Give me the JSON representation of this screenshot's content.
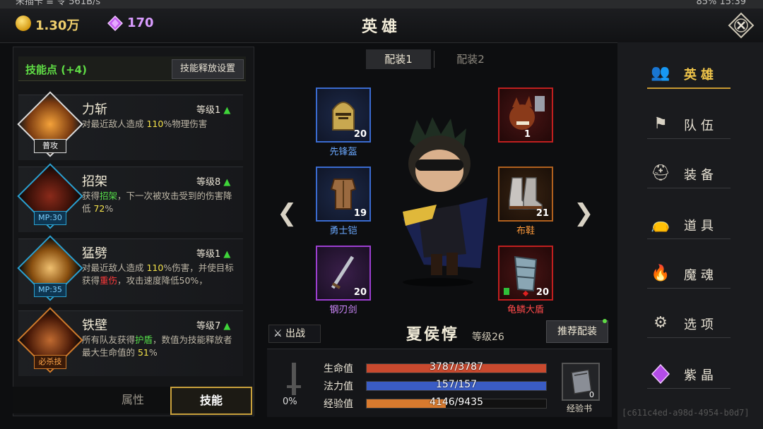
{
  "status_bar": {
    "left": "未插卡 ≡ 令 561B/s",
    "right": "85% 15:39"
  },
  "currency": {
    "gold": "1.30万",
    "gems": "170"
  },
  "title": "英雄",
  "skills_panel": {
    "points_label": "技能点 (+4)",
    "release_settings": "技能释放设置",
    "skills": [
      {
        "name": "力斩",
        "tag": "普攻",
        "level": "等级1",
        "desc_pre": "对最近敌人造成 ",
        "desc_hl": "110",
        "desc_post": "%物理伤害",
        "desc_hl2": "",
        "desc_post2": ""
      },
      {
        "name": "招架",
        "tag": "MP:30",
        "level": "等级8",
        "desc_pre": "获得",
        "desc_hl": "招架",
        "desc_post": "，下一次被攻击受到的伤害降低 ",
        "desc_hl2": "72",
        "desc_post2": "%"
      },
      {
        "name": "猛劈",
        "tag": "MP:35",
        "level": "等级1",
        "desc_pre": "对最近敌人造成 ",
        "desc_hl": "110",
        "desc_post": "%伤害，并使目标获得",
        "desc_hl2": "重伤",
        "desc_post2": "，攻击速度降低50%，"
      },
      {
        "name": "铁壁",
        "tag": "必杀技",
        "level": "等级7",
        "desc_pre": "所有队友获得",
        "desc_hl": "护盾",
        "desc_post": "，数值为技能释放者最大生命值的 ",
        "desc_hl2": "51",
        "desc_post2": "%"
      }
    ],
    "tabs": {
      "attributes": "属性",
      "skills": "技能"
    }
  },
  "loadout_tabs": [
    "配装1",
    "配装2"
  ],
  "equipment": {
    "helmet": {
      "label": "先锋盔",
      "count": "20",
      "icon": "helmet-icon",
      "color": "#3a6bd0"
    },
    "armor": {
      "label": "勇士铠",
      "count": "19",
      "icon": "armor-icon",
      "color": "#3a6bd0"
    },
    "sword": {
      "label": "钢刃剑",
      "count": "20",
      "icon": "sword-icon",
      "color": "#9c3fd0"
    },
    "pet": {
      "label": "",
      "count": "1",
      "icon": "werewolf-icon",
      "color": "#c01f1f"
    },
    "boots": {
      "label": "布鞋",
      "count": "21",
      "icon": "boots-icon",
      "color": "#b0601e"
    },
    "shield": {
      "label": "龟鳞大盾",
      "count": "20",
      "icon": "shield-icon",
      "color": "#c01f1f"
    }
  },
  "hero": {
    "deploy": "出战",
    "name": "夏侯惇",
    "level": "等级26",
    "recommend": "推荐配装"
  },
  "stats": {
    "hp": {
      "label": "生命值",
      "text": "3787/3787",
      "fraction": 1.0,
      "color": "#c9492e"
    },
    "mp": {
      "label": "法力值",
      "text": "157/157",
      "fraction": 1.0,
      "color": "#3a5cc4"
    },
    "exp": {
      "label": "经验值",
      "text": "4146/9435",
      "fraction": 0.44,
      "color": "#d87a2e"
    },
    "weapon_pct": "0%",
    "exp_book": {
      "label": "经验书",
      "count": "0"
    }
  },
  "nav": [
    "英雄",
    "队伍",
    "装备",
    "道具",
    "魔魂",
    "选项",
    "紫晶"
  ],
  "uid": "[c611c4ed-a98d-4954-b0d7]"
}
